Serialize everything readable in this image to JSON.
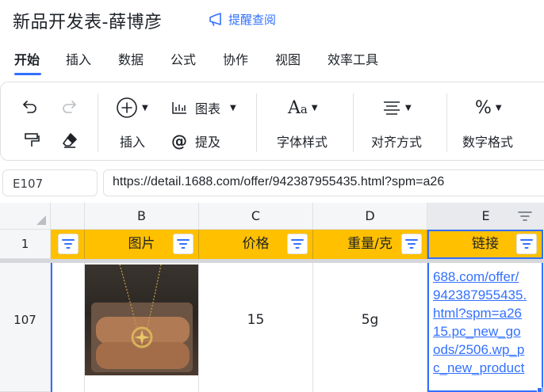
{
  "header": {
    "title": "新品开发表-薛博彦",
    "remind_label": "提醒查阅"
  },
  "menu": {
    "items": [
      "开始",
      "插入",
      "数据",
      "公式",
      "协作",
      "视图",
      "效率工具"
    ],
    "active": "开始"
  },
  "toolbar": {
    "insert_label": "插入",
    "chart_label": "图表",
    "mention_label": "提及",
    "font_style_label": "字体样式",
    "align_label": "对齐方式",
    "number_format_label": "数字格式"
  },
  "formula_bar": {
    "cell_ref": "E107",
    "value": "https://detail.1688.com/offer/942387955435.html?spm=a26"
  },
  "grid": {
    "columns": [
      "B",
      "C",
      "D",
      "E"
    ],
    "header_row_number": "1",
    "header_labels": [
      "图片",
      "价格",
      "重量/克",
      "链接"
    ],
    "row_number": "107",
    "price": "15",
    "weight": "5g",
    "link_lines": [
      "688.com/offer/",
      "942387955435.",
      "html?spm=a26",
      "15.pc_new_go",
      "ods/2506.wp_p",
      "c_new_product"
    ]
  },
  "colors": {
    "accent": "#3370ff",
    "header_fill": "#ffc000"
  }
}
